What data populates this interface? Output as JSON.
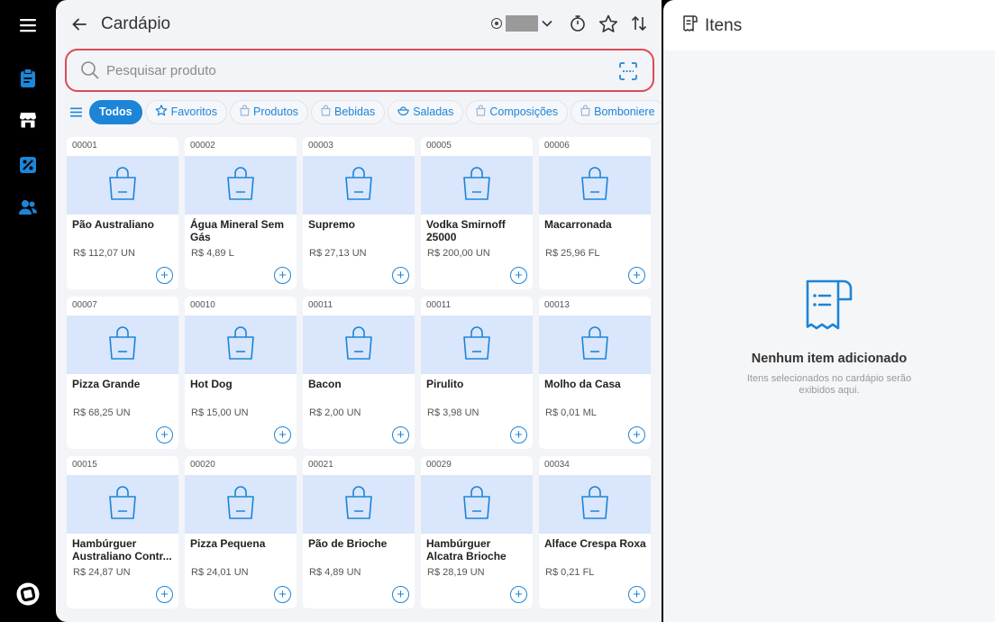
{
  "header": {
    "title": "Cardápio"
  },
  "search": {
    "placeholder": "Pesquisar produto"
  },
  "chips": [
    {
      "label": "Todos",
      "icon": "none",
      "active": true
    },
    {
      "label": "Favoritos",
      "icon": "star-icon",
      "active": false
    },
    {
      "label": "Produtos",
      "icon": "bag-icon",
      "active": false
    },
    {
      "label": "Bebidas",
      "icon": "bag-icon",
      "active": false
    },
    {
      "label": "Saladas",
      "icon": "salad-icon",
      "active": false
    },
    {
      "label": "Composições",
      "icon": "bag-icon",
      "active": false
    },
    {
      "label": "Bomboniere",
      "icon": "bag-icon",
      "active": false
    }
  ],
  "products": [
    {
      "code": "00001",
      "name": "Pão Australiano",
      "price": "R$ 112,07 UN"
    },
    {
      "code": "00002",
      "name": "Água Mineral Sem Gás",
      "price": "R$ 4,89 L"
    },
    {
      "code": "00003",
      "name": "Supremo",
      "price": "R$ 27,13 UN"
    },
    {
      "code": "00005",
      "name": "Vodka Smirnoff 25000",
      "price": "R$ 200,00 UN"
    },
    {
      "code": "00006",
      "name": "Macarronada",
      "price": "R$ 25,96 FL"
    },
    {
      "code": "00007",
      "name": "Pizza Grande",
      "price": "R$ 68,25 UN"
    },
    {
      "code": "00010",
      "name": "Hot Dog",
      "price": "R$ 15,00 UN"
    },
    {
      "code": "00011",
      "name": "Bacon",
      "price": "R$ 2,00 UN"
    },
    {
      "code": "00011",
      "name": "Pirulito",
      "price": "R$ 3,98 UN"
    },
    {
      "code": "00013",
      "name": "Molho da Casa",
      "price": "R$ 0,01 ML"
    },
    {
      "code": "00015",
      "name": "Hambúrguer Australiano Contr...",
      "price": "R$ 24,87 UN"
    },
    {
      "code": "00020",
      "name": "Pizza Pequena",
      "price": "R$ 24,01 UN"
    },
    {
      "code": "00021",
      "name": "Pão de Brioche",
      "price": "R$ 4,89 UN"
    },
    {
      "code": "00029",
      "name": "Hambúrguer Alcatra Brioche",
      "price": "R$ 28,19 UN"
    },
    {
      "code": "00034",
      "name": "Alface Crespa Roxa",
      "price": "R$ 0,21 FL"
    }
  ],
  "side_panel": {
    "title": "Itens",
    "empty_title": "Nenhum item adicionado",
    "empty_subtitle": "Itens selecionados no cardápio serão exibidos aqui."
  },
  "colors": {
    "accent": "#1c85d8",
    "search_border": "#dd4a55",
    "card_image_bg": "#d9e6fb"
  }
}
